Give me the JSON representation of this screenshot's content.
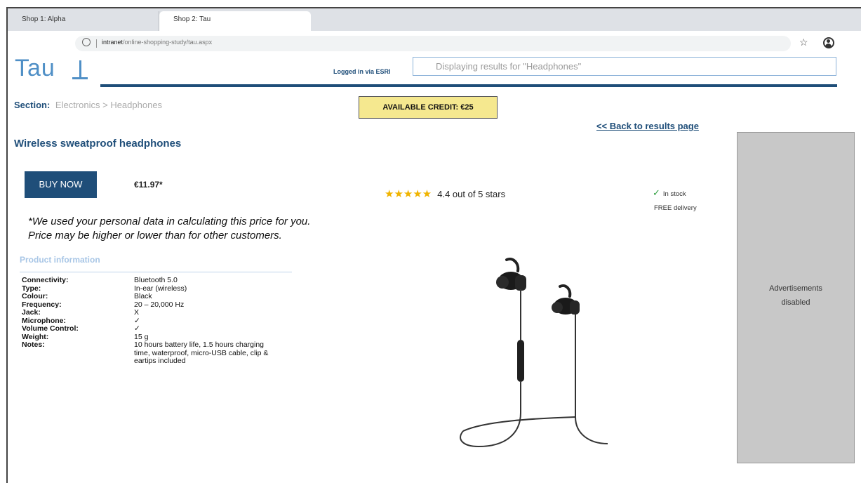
{
  "browser": {
    "tabs": [
      {
        "label": "Shop 1: Alpha",
        "active": false
      },
      {
        "label": "Shop 2: Tau",
        "active": true
      }
    ],
    "address": {
      "host": "intranet",
      "path": "/online-shopping-study/tau.aspx"
    },
    "icons": {
      "info": "info-icon",
      "bookmark": "star-icon",
      "account": "account-icon"
    }
  },
  "header": {
    "logo": "Tau",
    "logged_in": "Logged in via ESRI",
    "search_display": "Displaying results for   \"Headphones\""
  },
  "section": {
    "label": "Section:",
    "breadcrumb": "Electronics > Headphones"
  },
  "credit": "AVAILABLE CREDIT: €25",
  "back_link": "<< Back to results page",
  "product": {
    "title": "Wireless sweatproof headphones",
    "buy_label": "BUY NOW",
    "price": "€11.97*",
    "disclaimer_line1": "*We used your personal data in calculating this price for you.",
    "disclaimer_line2": "Price may be higher or lower than for other customers.",
    "rating_stars": "★★★★★",
    "rating_value": 4.4,
    "rating_text": "4.4 out of 5 stars",
    "stock": "In stock",
    "delivery": "FREE delivery",
    "info_heading": "Product information",
    "specs": [
      {
        "k": "Connectivity:",
        "v": "Bluetooth 5.0"
      },
      {
        "k": "Type:",
        "v": "In-ear (wireless)"
      },
      {
        "k": "Colour:",
        "v": "Black"
      },
      {
        "k": "Frequency:",
        "v": "20 – 20,000 Hz"
      },
      {
        "k": "Jack:",
        "v": "X"
      },
      {
        "k": "Microphone:",
        "v": "✓"
      },
      {
        "k": "Volume Control:",
        "v": "✓"
      },
      {
        "k": "Weight:",
        "v": "15 g"
      },
      {
        "k": "Notes:",
        "v": "10 hours battery life, 1.5 hours charging time, waterproof, micro-USB cable, clip & eartips included"
      }
    ]
  },
  "ads": {
    "text": "Advertisements disabled"
  },
  "colors": {
    "brand": "#1f4e79",
    "logo": "#4f8fc6",
    "credit_bg": "#f5e88f",
    "star": "#f0b400",
    "ad_bg": "#c8c8c8"
  }
}
